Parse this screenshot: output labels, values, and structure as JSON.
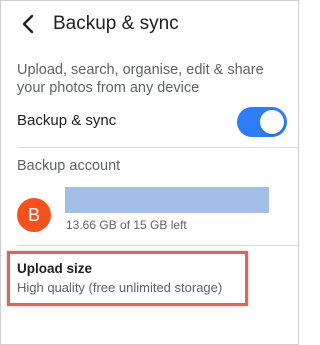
{
  "header": {
    "title": "Backup & sync",
    "back_icon": "chevron-left-icon"
  },
  "description": "Upload, search, organise, edit & share your photos from any device",
  "backup_sync": {
    "label": "Backup & sync",
    "enabled": true,
    "toggle_color": "#2f7df6"
  },
  "backup_account": {
    "section_label": "Backup account",
    "avatar_letter": "B",
    "avatar_color": "#f4511e",
    "storage": "13.66 GB of 15 GB left"
  },
  "upload_size": {
    "title": "Upload size",
    "value": "High quality (free unlimited storage)",
    "highlight_color": "#e8605b"
  }
}
